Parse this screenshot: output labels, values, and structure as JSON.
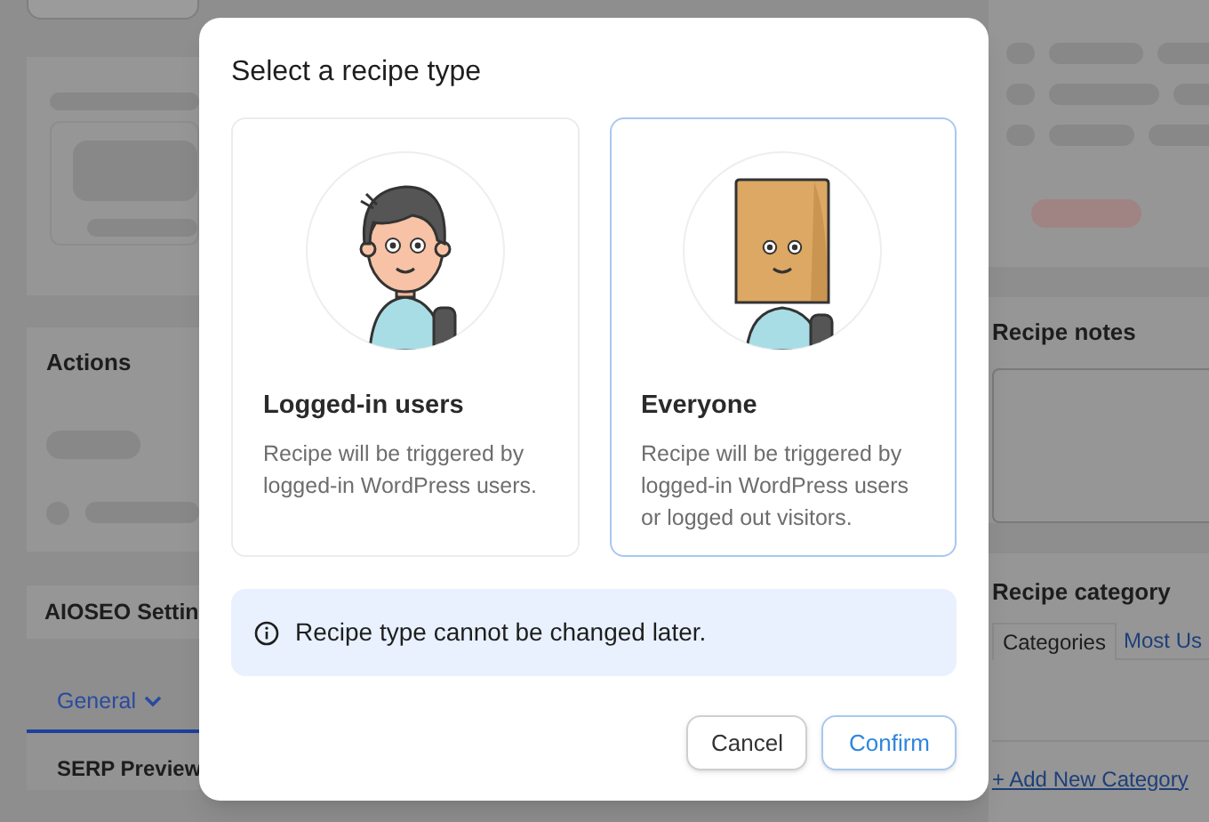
{
  "background": {
    "left": {
      "actions_heading": "Actions",
      "settings_heading": "AIOSEO Settin",
      "tabs": [
        {
          "label": "General",
          "selected": true
        }
      ],
      "section_heading": "SERP Preview"
    },
    "right": {
      "notes_heading": "Recipe notes",
      "category_heading": "Recipe category",
      "category_tabs": [
        {
          "label": "Categories",
          "selected": true
        },
        {
          "label": "Most Us",
          "selected": false
        }
      ],
      "add_link": "+ Add New Category"
    }
  },
  "modal": {
    "title": "Select a recipe type",
    "options": [
      {
        "kind": "person",
        "title": "Logged-in users",
        "description": "Recipe will be triggered by logged-in WordPress users.",
        "selected": false
      },
      {
        "kind": "bag",
        "title": "Everyone",
        "description": "Recipe will be triggered by logged-in WordPress users or logged out visitors.",
        "selected": true
      }
    ],
    "notice": "Recipe type cannot be changed later.",
    "buttons": [
      {
        "kind": "secondary",
        "label": "Cancel"
      },
      {
        "kind": "primary",
        "label": "Confirm"
      }
    ]
  }
}
